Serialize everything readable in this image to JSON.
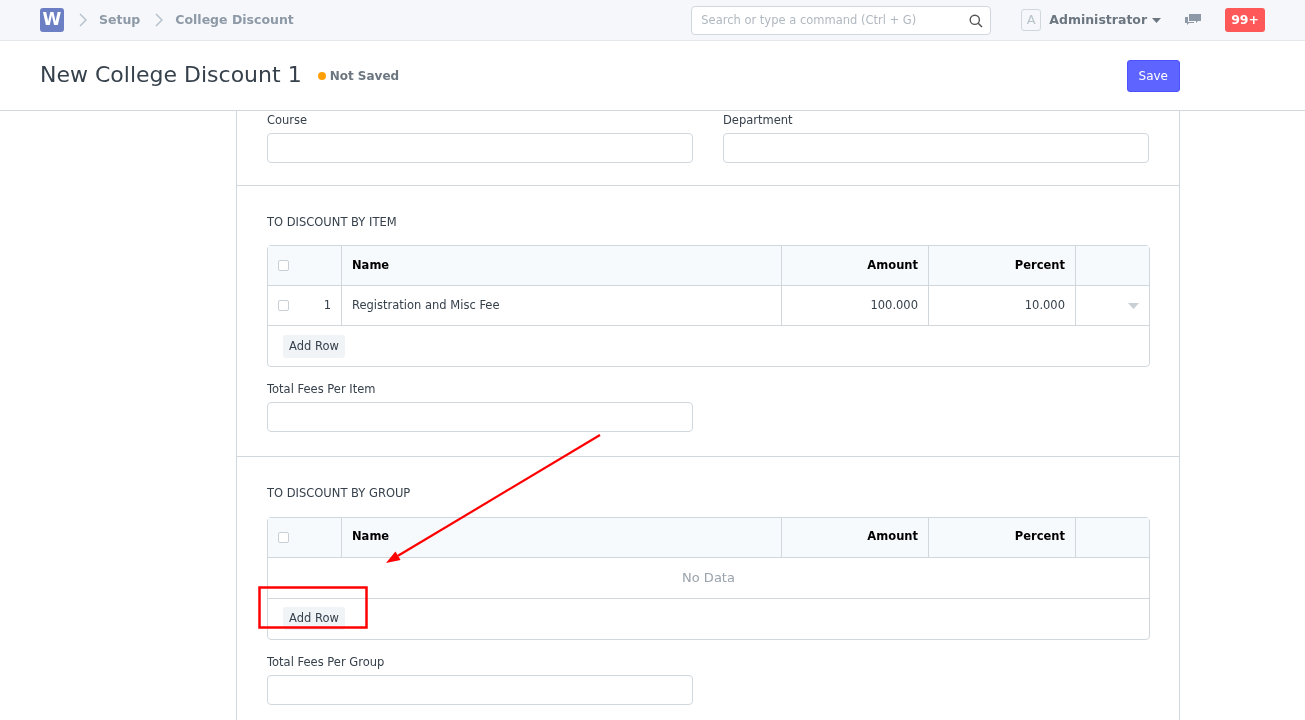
{
  "navbar": {
    "logo": "W",
    "breadcrumbs": [
      "Setup",
      "College Discount"
    ],
    "search": {
      "placeholder": "Search or type a command (Ctrl + G)"
    },
    "avatar": "A",
    "user": "Administrator",
    "notifications": "99+"
  },
  "page": {
    "title": "New College Discount 1",
    "status": "Not Saved",
    "primary_action": "Save"
  },
  "sections": [
    {
      "kind": "fields",
      "fields": [
        {
          "label": "Course"
        },
        {
          "label": "Department"
        }
      ]
    },
    {
      "kind": "table",
      "title": "TO DISCOUNT BY ITEM",
      "select_all_checked": false,
      "columns": [
        "Name",
        "Amount",
        "Percent"
      ],
      "rows": [
        {
          "index": "1",
          "name": "Registration and Misc Fee",
          "amount": "100.000",
          "percent": "10.000",
          "checked": false
        }
      ],
      "add_button": "Add Row",
      "total_label": "Total Fees Per Item"
    },
    {
      "kind": "table",
      "title": "TO DISCOUNT BY GROUP",
      "select_all_checked": false,
      "columns": [
        "Name",
        "Amount",
        "Percent"
      ],
      "empty_text": "No Data",
      "add_button": "Add Row",
      "total_label": "Total Fees Per Group"
    }
  ],
  "annotations": [
    {
      "kind": "arrow"
    },
    {
      "kind": "highlight"
    }
  ]
}
